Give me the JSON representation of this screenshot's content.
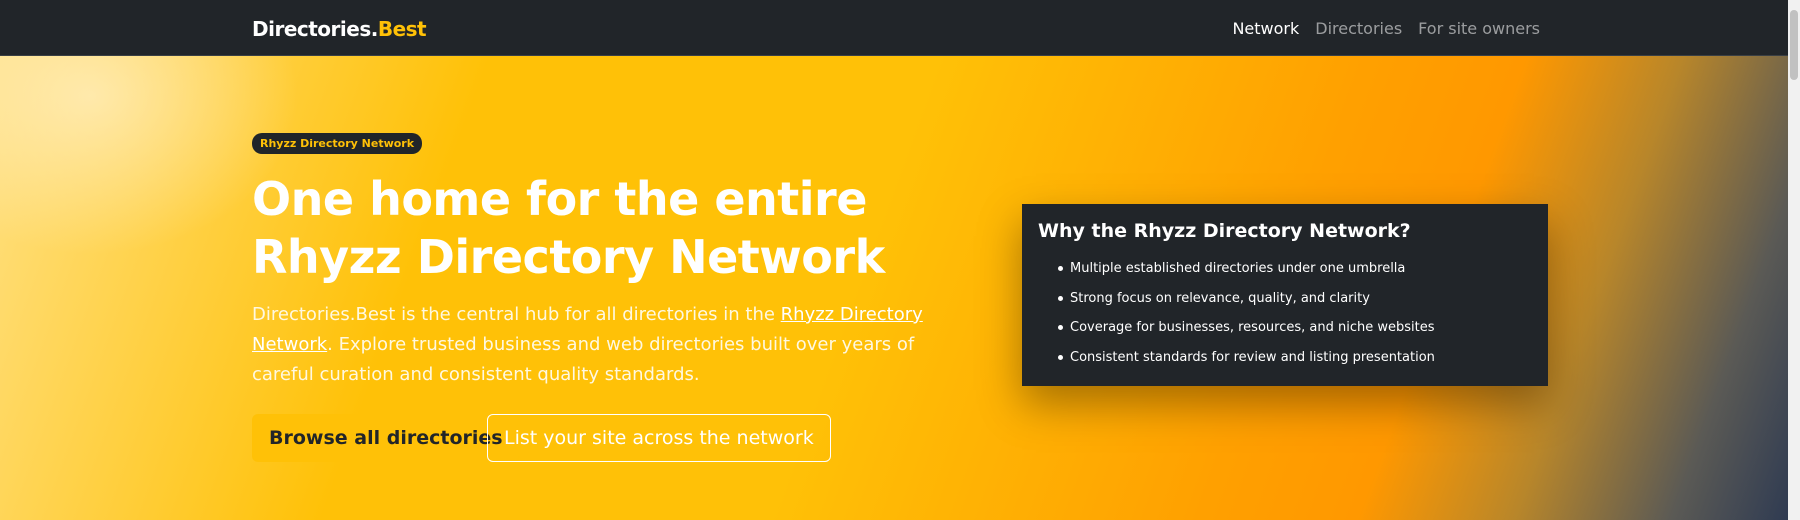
{
  "navbar": {
    "brand_main": "Directories.",
    "brand_accent": "Best",
    "links": [
      {
        "label": "Network"
      },
      {
        "label": "Directories"
      },
      {
        "label": "For site owners"
      }
    ]
  },
  "hero": {
    "badge": "Rhyzz Directory Network",
    "title": "One home for the entire Rhyzz Directory Network",
    "lead_before": "Directories.Best is the central hub for all directories in the ",
    "lead_link": "Rhyzz Directory Network",
    "lead_after": ". Explore trusted business and web directories built over years of careful curation and consistent quality standards.",
    "primary_button": "Browse all directories",
    "secondary_button": "List your site across the network"
  },
  "card": {
    "title": "Why the Rhyzz Directory Network?",
    "items": [
      "Multiple established directories under one umbrella",
      "Strong focus on relevance, quality, and clarity",
      "Coverage for businesses, resources, and niche websites",
      "Consistent standards for review and listing presentation"
    ]
  },
  "colors": {
    "accent": "#ffc107",
    "dark": "#212529"
  }
}
